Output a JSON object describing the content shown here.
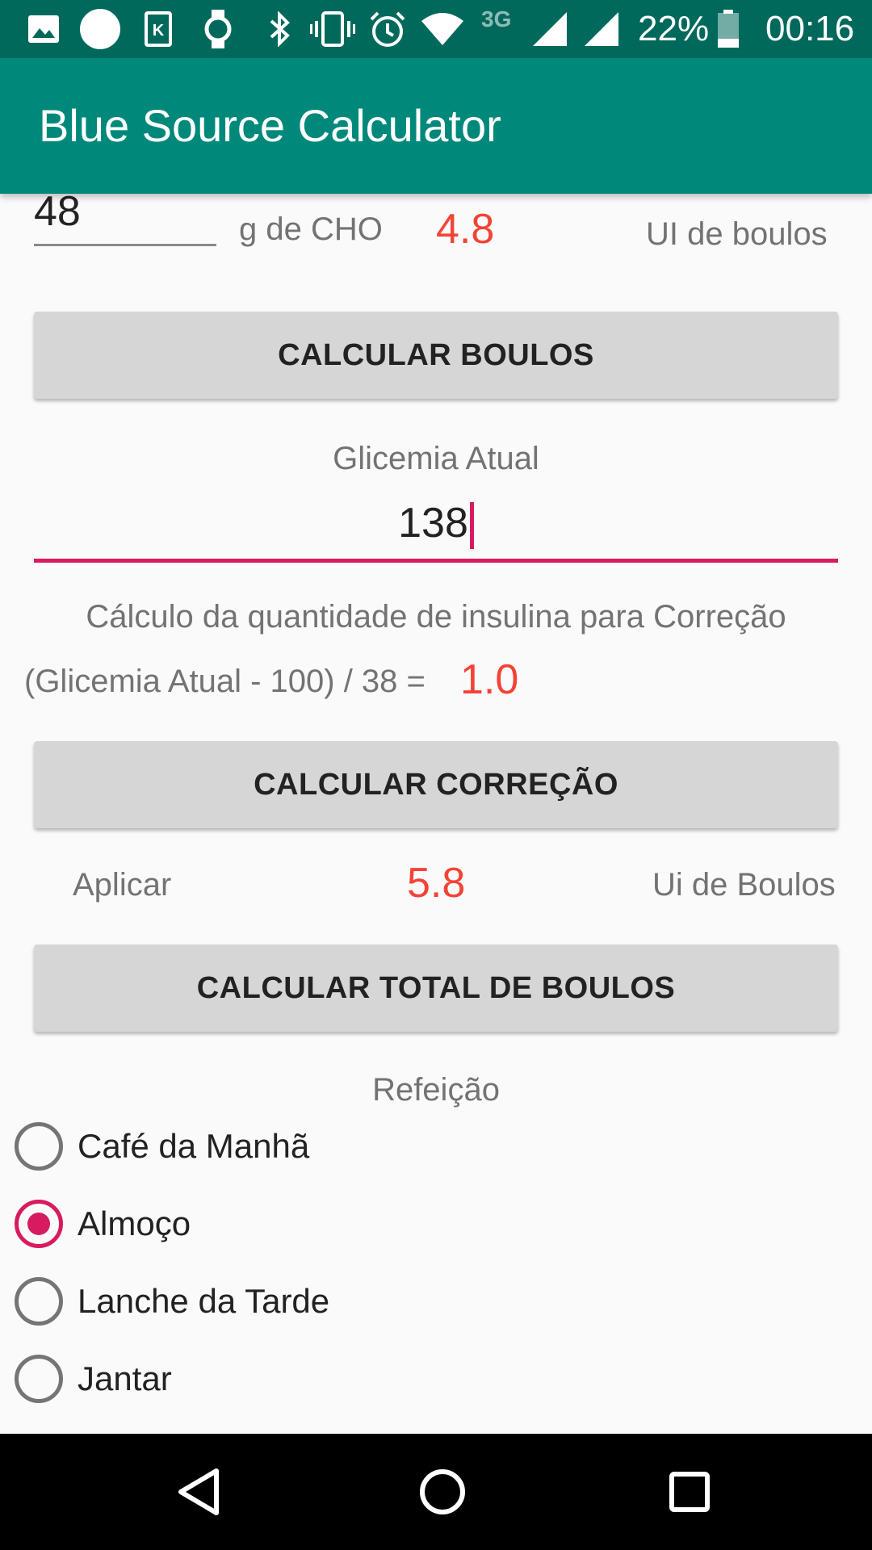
{
  "status_bar": {
    "network_type": "3G",
    "battery_percent": "22%",
    "time": "00:16",
    "icons": [
      "image-icon",
      "circle-icon",
      "k-app-icon",
      "watch-icon",
      "bluetooth-icon",
      "vibrate-icon",
      "alarm-icon",
      "wifi-icon",
      "signal-icon",
      "signal-icon",
      "battery-icon"
    ]
  },
  "app_bar": {
    "title": "Blue Source Calculator"
  },
  "cho": {
    "input_value": "48",
    "unit_label": "g de CHO",
    "result_value": "4.8",
    "result_unit": "UI de boulos"
  },
  "buttons": {
    "calc_boulos": "CALCULAR BOULOS",
    "calc_correcao": "CALCULAR CORREÇÃO",
    "calc_total": "CALCULAR TOTAL DE BOULOS"
  },
  "glicemia": {
    "label": "Glicemia Atual",
    "value": "138"
  },
  "correction": {
    "title": "Cálculo da quantidade de insulina para Correção",
    "formula": "(Glicemia Atual - 100) / 38 =",
    "result": "1.0"
  },
  "total": {
    "prefix": "Aplicar",
    "value": "5.8",
    "unit": "Ui de Boulos"
  },
  "meal": {
    "label": "Refeição",
    "options": [
      {
        "label": "Café da Manhã",
        "checked": false
      },
      {
        "label": "Almoço",
        "checked": true
      },
      {
        "label": "Lanche da Tarde",
        "checked": false
      },
      {
        "label": "Jantar",
        "checked": false
      }
    ]
  },
  "colors": {
    "primary": "#00897b",
    "primary_dark": "#00695c",
    "accent": "#d81b60",
    "result_red": "#f44336"
  }
}
